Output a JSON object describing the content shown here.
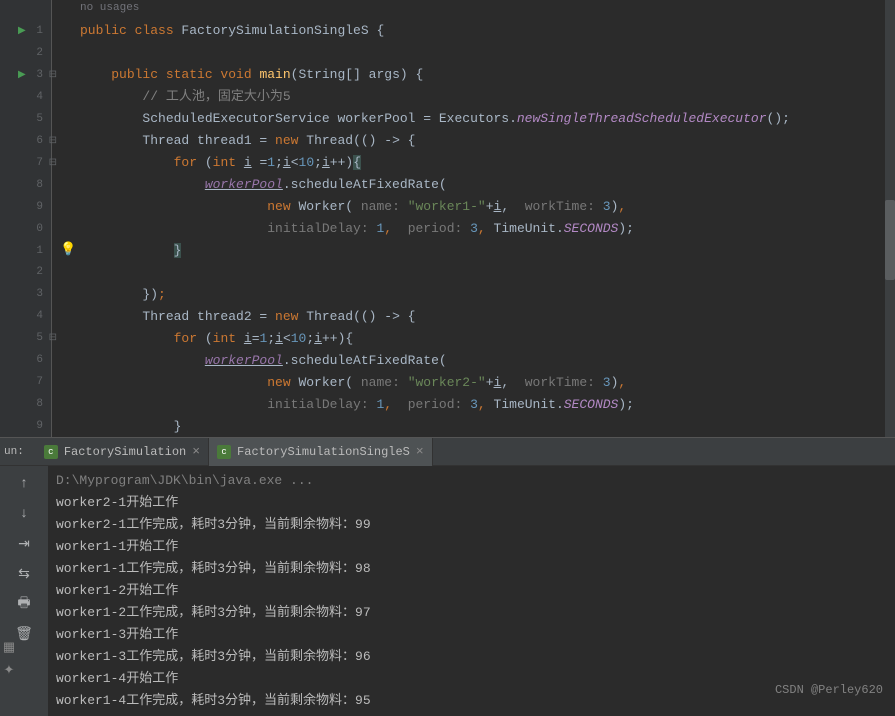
{
  "editor": {
    "noUsages": "no usages",
    "lines": [
      {
        "n": "1",
        "run": true,
        "html": "<span class='k-orange'>public class </span><span>FactorySimulationSingleS </span>{"
      },
      {
        "n": "2",
        "html": ""
      },
      {
        "n": "3",
        "run": true,
        "fold": true,
        "html": "    <span class='k-orange'>public static void </span><span class='k-yellow'>main</span>(String[] args) {"
      },
      {
        "n": "4",
        "html": "        <span class='k-gray'>// 工人池，固定大小为5</span>"
      },
      {
        "n": "5",
        "html": "        ScheduledExecutorService workerPool = Executors.<span class='k-static'>newSingleThreadScheduledExecutor</span>();"
      },
      {
        "n": "6",
        "fold": true,
        "html": "        Thread thread1 = <span class='k-orange'>new </span>Thread(() -> {"
      },
      {
        "n": "7",
        "fold": true,
        "html": "            <span class='k-orange'>for </span>(<span class='k-orange'>int </span><span class='k-underline'>i</span> =<span class='k-num'>1</span>;<span class='k-underline'>i</span>&lt;<span class='k-num'>10</span>;<span class='k-underline'>i</span>++)<span class='hl-brace'>{</span>"
      },
      {
        "n": "8",
        "html": "                <span class='k-italic k-underline'>workerPool</span>.scheduleAtFixedRate("
      },
      {
        "n": "9",
        "html": "                        <span class='k-orange'>new </span>Worker( <span class='k-hint'>name: </span><span class='k-green'>\"worker1-\"</span>+<span class='k-underline'>i</span>,  <span class='k-hint'>workTime: </span><span class='k-num'>3</span>)<span class='k-orange'>,</span>"
      },
      {
        "n": "0",
        "html": "                        <span class='k-hint'>initialDelay: </span><span class='k-num'>1</span><span class='k-orange'>,</span>  <span class='k-hint'>period: </span><span class='k-num'>3</span><span class='k-orange'>,</span> TimeUnit.<span class='k-static'>SECONDS</span>);"
      },
      {
        "n": "1",
        "bulb": true,
        "html": "            <span class='hl-brace'>}</span>"
      },
      {
        "n": "2",
        "html": ""
      },
      {
        "n": "3",
        "html": "        })<span class='k-orange'>;</span>"
      },
      {
        "n": "4",
        "html": "        Thread thread2 = <span class='k-orange'>new </span>Thread(() -> {"
      },
      {
        "n": "5",
        "fold": true,
        "html": "            <span class='k-orange'>for </span>(<span class='k-orange'>int </span><span class='k-underline'>i</span>=<span class='k-num'>1</span>;<span class='k-underline'>i</span>&lt;<span class='k-num'>10</span>;<span class='k-underline'>i</span>++){"
      },
      {
        "n": "6",
        "html": "                <span class='k-italic k-underline'>workerPool</span>.scheduleAtFixedRate("
      },
      {
        "n": "7",
        "html": "                        <span class='k-orange'>new </span>Worker( <span class='k-hint'>name: </span><span class='k-green'>\"worker2-\"</span>+<span class='k-underline'>i</span>,  <span class='k-hint'>workTime: </span><span class='k-num'>3</span>)<span class='k-orange'>,</span>"
      },
      {
        "n": "8",
        "html": "                        <span class='k-hint'>initialDelay: </span><span class='k-num'>1</span><span class='k-orange'>,</span>  <span class='k-hint'>period: </span><span class='k-num'>3</span><span class='k-orange'>,</span> TimeUnit.<span class='k-static'>SECONDS</span>);"
      },
      {
        "n": "9",
        "html": "            }"
      }
    ]
  },
  "run": {
    "label": "un:",
    "tabs": [
      {
        "name": "FactorySimulation",
        "active": false
      },
      {
        "name": "FactorySimulationSingleS",
        "active": true
      }
    ],
    "console": [
      {
        "cls": "console-cmd",
        "text": "D:\\Myprogram\\JDK\\bin\\java.exe ..."
      },
      {
        "text": "worker2-1开始工作"
      },
      {
        "text": "worker2-1工作完成，耗时3分钟，当前剩余物料：99"
      },
      {
        "text": "worker1-1开始工作"
      },
      {
        "text": "worker1-1工作完成，耗时3分钟，当前剩余物料：98"
      },
      {
        "text": "worker1-2开始工作"
      },
      {
        "text": "worker1-2工作完成，耗时3分钟，当前剩余物料：97"
      },
      {
        "text": "worker1-3开始工作"
      },
      {
        "text": "worker1-3工作完成，耗时3分钟，当前剩余物料：96"
      },
      {
        "text": "worker1-4开始工作"
      },
      {
        "text": "worker1-4工作完成，耗时3分钟，当前剩余物料：95"
      }
    ]
  },
  "toolbar": {
    "icons": [
      "↑",
      "↓",
      "⇥",
      "⇆",
      "🖶",
      "🗑"
    ]
  },
  "watermark": "CSDN @Perley620"
}
